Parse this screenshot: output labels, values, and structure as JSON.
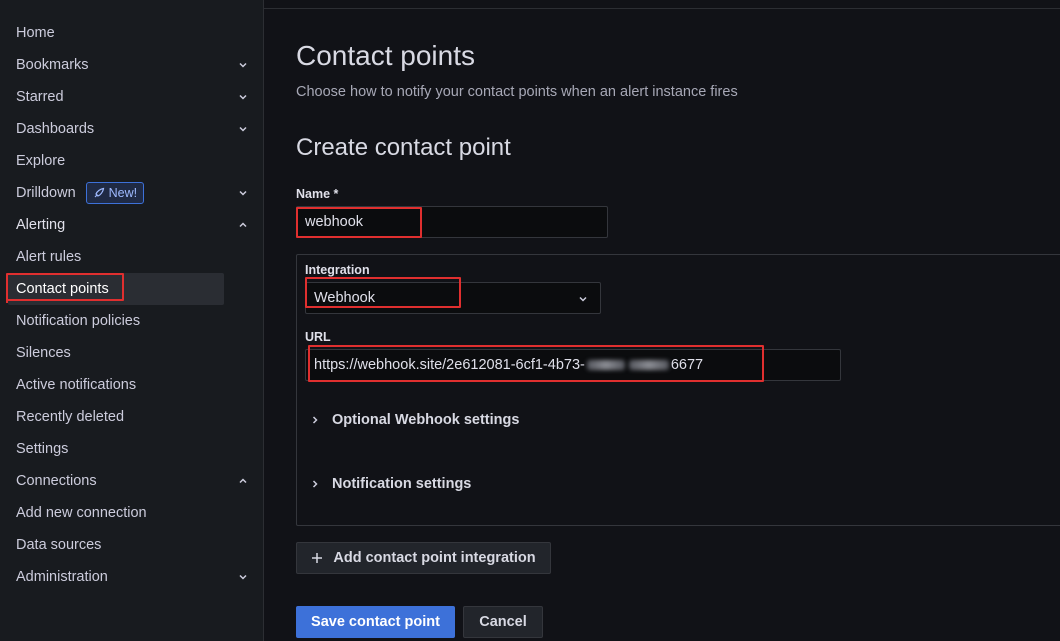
{
  "sidebar": {
    "items": [
      {
        "label": "Home"
      },
      {
        "label": "Bookmarks"
      },
      {
        "label": "Starred"
      },
      {
        "label": "Dashboards"
      },
      {
        "label": "Explore"
      },
      {
        "label": "Drilldown",
        "badge": "New!"
      },
      {
        "label": "Alerting"
      },
      {
        "label": "Alert rules"
      },
      {
        "label": "Contact points"
      },
      {
        "label": "Notification policies"
      },
      {
        "label": "Silences"
      },
      {
        "label": "Active notifications"
      },
      {
        "label": "Recently deleted"
      },
      {
        "label": "Settings"
      },
      {
        "label": "Connections"
      },
      {
        "label": "Add new connection"
      },
      {
        "label": "Data sources"
      },
      {
        "label": "Administration"
      }
    ]
  },
  "page": {
    "title": "Contact points",
    "subtitle": "Choose how to notify your contact points when an alert instance fires",
    "section_title": "Create contact point"
  },
  "form": {
    "name_label": "Name *",
    "name_value": "webhook",
    "integration_label": "Integration",
    "integration_value": "Webhook",
    "url_label": "URL",
    "url_value_start": "https://webhook.site/2e612081-6cf1-4b73-",
    "url_value_end": "6677",
    "optional_settings": "Optional Webhook settings",
    "notification_settings": "Notification settings",
    "add_integration": "Add contact point integration",
    "save": "Save contact point",
    "cancel": "Cancel"
  },
  "colors": {
    "accent": "#3d71d9",
    "highlight": "#e02f2f",
    "background": "#111217"
  }
}
